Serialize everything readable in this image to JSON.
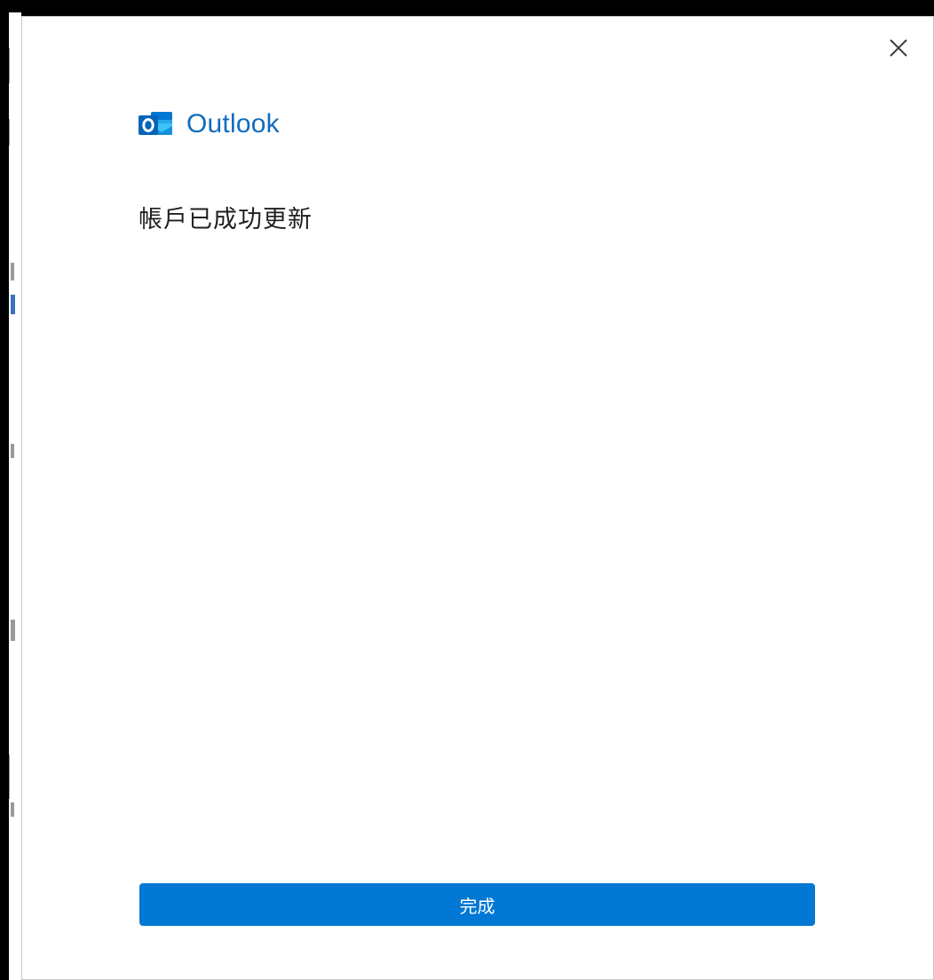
{
  "app": {
    "brand_name": "Outlook",
    "brand_color": "#0f6cbd"
  },
  "dialog": {
    "message": "帳戶已成功更新",
    "close_icon": "close-icon",
    "done_label": "完成",
    "done_color": "#0078d4"
  }
}
